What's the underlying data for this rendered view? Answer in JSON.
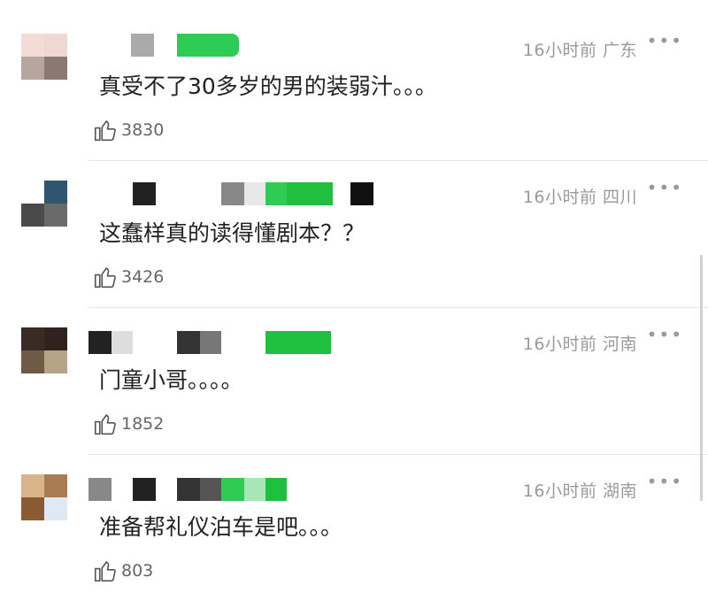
{
  "comments": [
    {
      "time_location": "16小时前 广东",
      "text": "真受不了30多岁的男的装弱汁。。。",
      "likes": "3830",
      "avatar_colors": [
        "#f4dcd6",
        "#f0d8d2",
        "#b7a69f",
        "#8c7872"
      ],
      "name_blur_colors": [
        "#ffffff",
        "#aaaaaa",
        "#ffffff",
        "#2ecc55"
      ]
    },
    {
      "time_location": "16小时前 四川",
      "text": "这蠢样真的读得懂剧本？？",
      "likes": "3426",
      "avatar_colors": [
        "#ffffff",
        "#2f5570",
        "#4a4a4a",
        "#6a6a6a"
      ],
      "name_blur_colors": [
        "#ffffff",
        "#222222",
        "#ffffff",
        "#888888",
        "#2ecc55",
        "#111111"
      ]
    },
    {
      "time_location": "16小时前 河南",
      "text": "门童小哥。。。。",
      "likes": "1852",
      "avatar_colors": [
        "#3a2c24",
        "#2e241d",
        "#6e5a46",
        "#b5a488"
      ],
      "name_blur_colors": [
        "#222222",
        "#dddddd",
        "#ffffff",
        "#333333",
        "#777777",
        "#ffffff",
        "#1fbf3f"
      ]
    },
    {
      "time_location": "16小时前 湖南",
      "text": "准备帮礼仪泊车是吧。。。",
      "likes": "803",
      "avatar_colors": [
        "#d9b48a",
        "#a97c55",
        "#8a5a32",
        "#dfe9f5"
      ],
      "name_blur_colors": [
        "#888888",
        "#ffffff",
        "#222222",
        "#ffffff",
        "#333333",
        "#2ecc55",
        "#a8e6b8",
        "#1fbf3f"
      ]
    }
  ],
  "more_icon": "more-dots-icon",
  "like_icon": "thumbs-up-icon"
}
